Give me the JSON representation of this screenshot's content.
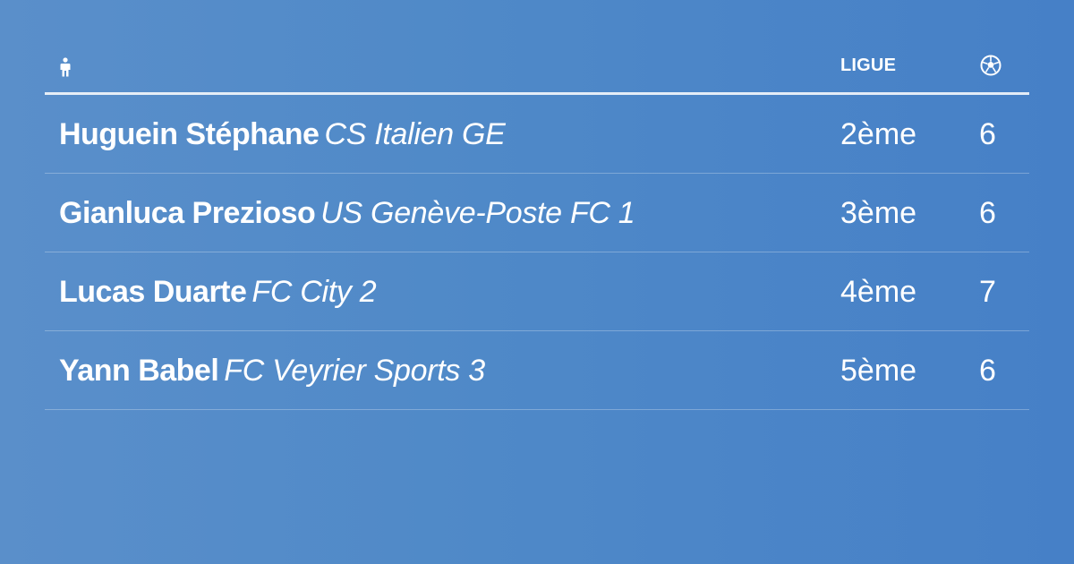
{
  "header": {
    "player_icon": "person-icon",
    "league_label": "LIGUE",
    "goals_icon": "soccer-ball-icon"
  },
  "rows": [
    {
      "player": "Huguein Stéphane",
      "club": "CS Italien GE",
      "league": "2ème",
      "goals": "6"
    },
    {
      "player": "Gianluca Prezioso",
      "club": "US Genève-Poste FC 1",
      "league": "3ème",
      "goals": "6"
    },
    {
      "player": "Lucas Duarte",
      "club": "FC City 2",
      "league": "4ème",
      "goals": "7"
    },
    {
      "player": "Yann Babel",
      "club": "FC Veyrier Sports 3",
      "league": "5ème",
      "goals": "6"
    }
  ],
  "colors": {
    "background": "#4f89c8",
    "text": "#ffffff"
  }
}
